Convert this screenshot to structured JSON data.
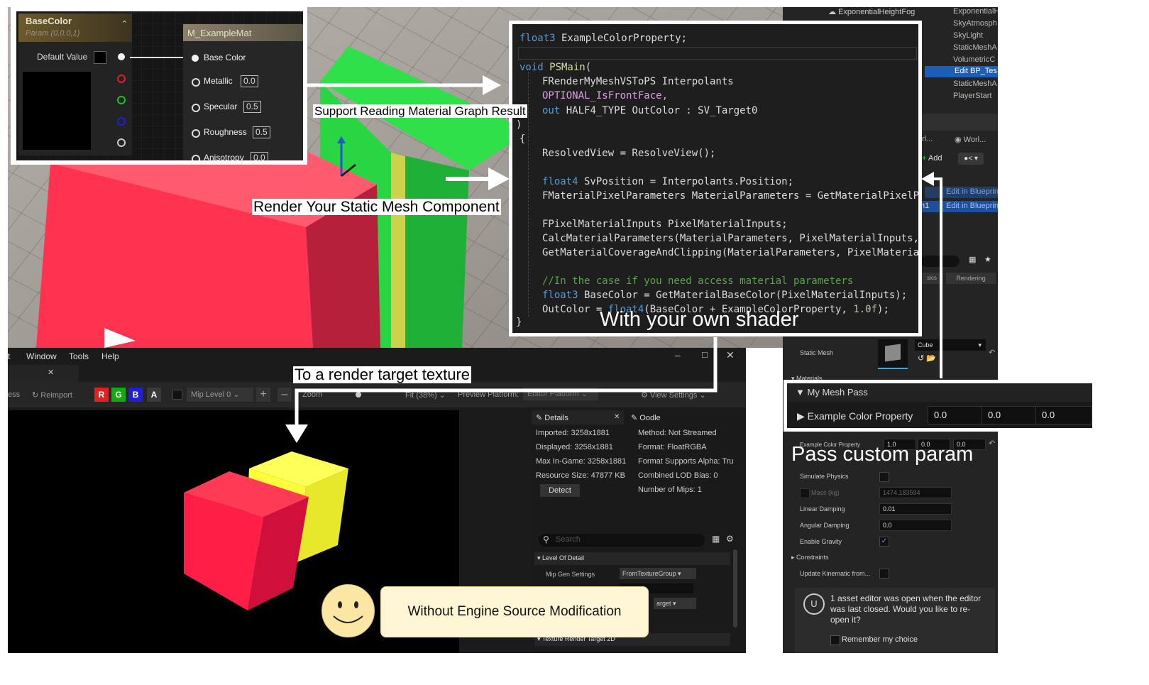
{
  "material_graph": {
    "param_title": "BaseColor",
    "param_subtitle": "Param (0,0,0,1)",
    "default_value_label": "Default Value",
    "material_title": "M_ExampleMat",
    "inputs": [
      {
        "label": "Base Color",
        "value": ""
      },
      {
        "label": "Metallic",
        "value": "0.0"
      },
      {
        "label": "Specular",
        "value": "0.5"
      },
      {
        "label": "Roughness",
        "value": "0.5"
      },
      {
        "label": "Anisotropy",
        "value": "0.0"
      }
    ]
  },
  "code": {
    "l1_type": "float3",
    "l1_rest": " ExampleColorProperty;",
    "l2_kw": "void",
    "l2_fn": " PSMain",
    "l2_rest": "(",
    "l3": "FRenderMyMeshVSToPS Interpolants",
    "l4": "OPTIONAL_IsFrontFace,",
    "l5_kw": "out",
    "l5_rest": " HALF4_TYPE OutColor : SV_Target0",
    "l6": ")",
    "l7": "{",
    "l8": "ResolvedView = ResolveView();",
    "l9_type": "float4",
    "l9_rest": " SvPosition = Interpolants.Position;",
    "l10": "FMaterialPixelParameters MaterialParameters = GetMaterialPixelPar",
    "l11": "FPixelMaterialInputs PixelMaterialInputs;",
    "l12": "CalcMaterialParameters(MaterialParameters, PixelMaterialInputs, S",
    "l13": "GetMaterialCoverageAndClipping(MaterialParameters, PixelMaterialI",
    "l14": "//In the case if you need access material parameters",
    "l15_type": "float3",
    "l15_rest": " BaseColor = GetMaterialBaseColor(PixelMaterialInputs);",
    "l16_a": "OutColor = ",
    "l16_type": "float4",
    "l16_b": "(BaseColor + ExampleColorProperty, ",
    "l16_num": "1.0f",
    "l16_c": ");",
    "l17": "}"
  },
  "callouts": {
    "support": "Support Reading Material Graph Result",
    "render": "Render Your Static Mesh Component",
    "shader": "With your own shader",
    "render_target": "To a render target texture",
    "pass_param": "Pass custom param",
    "engine": "Without Engine Source Modification"
  },
  "outliner": {
    "top_item": "ExponentialHeightFog",
    "items": [
      "ExponentialH",
      "SkyAtmosph",
      "SkyLight",
      "StaticMeshA",
      "VolumetricC",
      "Edit BP_Tes",
      "StaticMeshA",
      "PlayerStart"
    ],
    "world_label": "Worl...",
    "add_label": "Add",
    "edit_bp_1": "Edit in Blueprin",
    "edit_bp_2": "Edit in Blueprin",
    "tab_physics": "sics",
    "tab_rendering": "Rendering",
    "static_mesh_label": "Static Mesh",
    "static_mesh_value": "Cube",
    "materials_label": "Materials"
  },
  "mesh_pass": {
    "title": "My Mesh Pass",
    "property": "Example Color Property",
    "values": [
      "0.0",
      "0.0",
      "0.0"
    ]
  },
  "physics": {
    "example_prop_label": "Example Color Property",
    "example_values": [
      "1.0",
      "0.0",
      "0.0"
    ],
    "rows": [
      {
        "label": "Simulate Physics",
        "value": ""
      },
      {
        "label": "Mass (kg)",
        "value": "1474.183594"
      },
      {
        "label": "Linear Damping",
        "value": "0.01"
      },
      {
        "label": "Angular Damping",
        "value": "0.0"
      },
      {
        "label": "Enable Gravity",
        "value": ""
      },
      {
        "label": "Constraints",
        "value": ""
      },
      {
        "label": "Update Kinematic from...",
        "value": ""
      }
    ]
  },
  "notification": {
    "message": "1 asset editor was open when the editor was last closed. Would you like to re-open it?",
    "remember": "Remember my choice"
  },
  "texture_editor": {
    "menu": [
      "t",
      "Window",
      "Tools",
      "Help"
    ],
    "reimport": "Reimport",
    "channels": [
      "R",
      "G",
      "B",
      "A"
    ],
    "mip_level": "Mip Level 0",
    "zoom": "Zoom",
    "fit": "Fit (38%)",
    "preview_platform": "Preview Platform:",
    "editor_platform": "Editor Platform",
    "view_settings": "View Settings",
    "details_tab": "Details",
    "oodle_tab": "Oodle",
    "details_left": [
      "Imported: 3258x1881",
      "Displayed: 3258x1881",
      "Max In-Game: 3258x1881",
      "Resource Size: 47877 KB"
    ],
    "details_right": [
      "Method: Not Streamed",
      "Format: FloatRGBA",
      "Format Supports Alpha: Tru",
      "Combined LOD Bias: 0",
      "Number of Mips: 1"
    ],
    "detect": "Detect",
    "search_placeholder": "Search",
    "lod_section": "Level Of Detail",
    "mip_gen_label": "Mip Gen Settings",
    "mip_gen_value": "FromTextureGroup",
    "target_value": "arget",
    "trt_section": "Texture Render Target 2D"
  },
  "colors": {
    "red_cube": "#ff3350",
    "green_cube": "#36ec4f",
    "yellow_cube": "#ffff3a",
    "accent_blue": "#2f6fd1"
  }
}
